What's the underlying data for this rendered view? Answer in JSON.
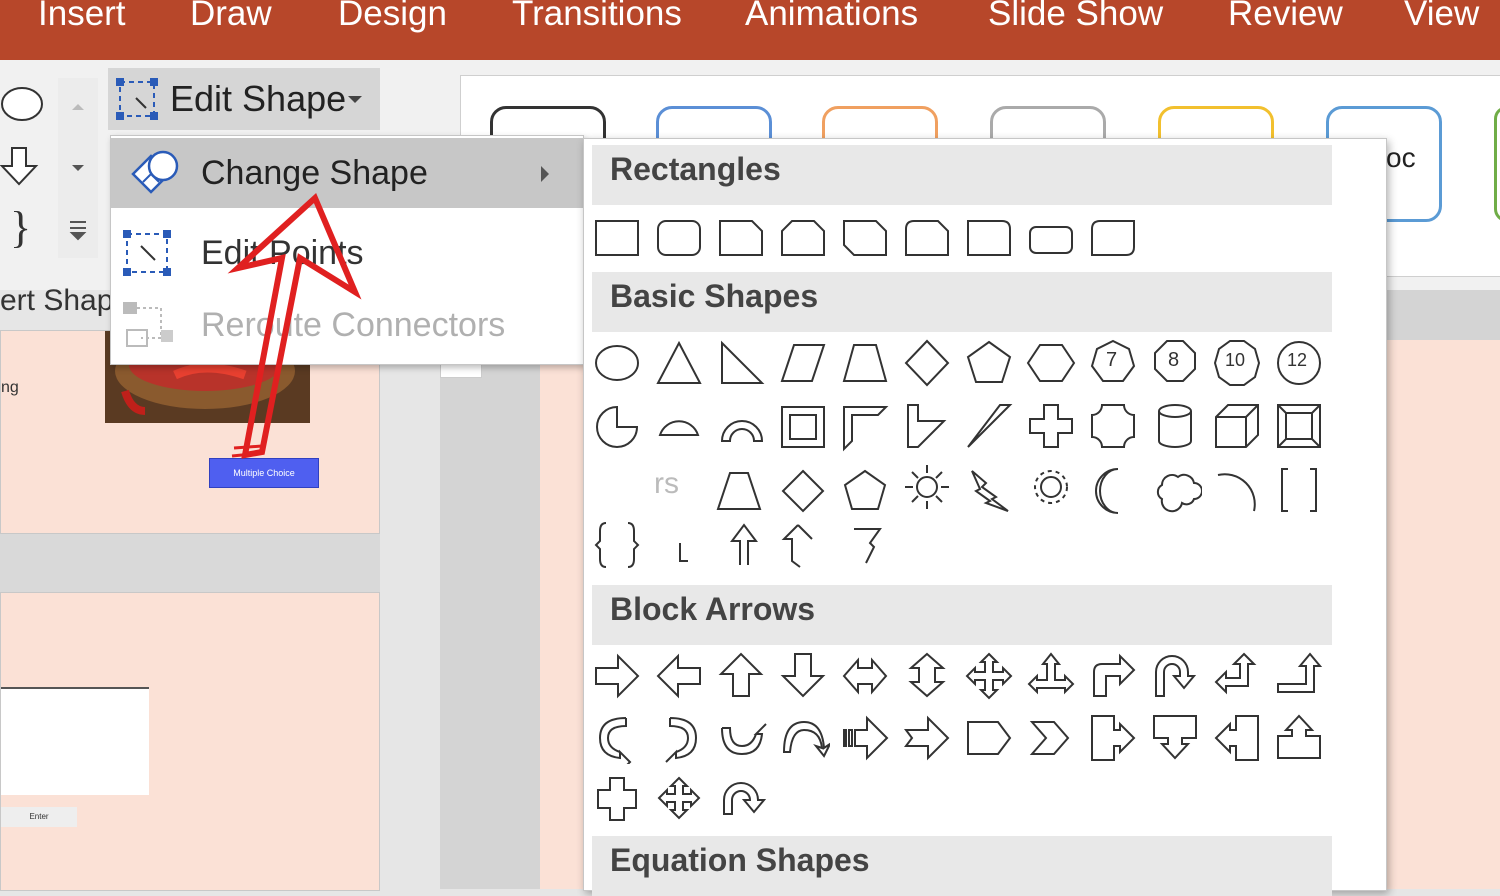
{
  "ribbon_tabs": [
    "Insert",
    "Draw",
    "Design",
    "Transitions",
    "Animations",
    "Slide Show",
    "Review",
    "View"
  ],
  "insert_shapes_label": "ert Shap",
  "edit_shape": {
    "button_label": "Edit Shape",
    "menu": [
      {
        "label": "Change Shape",
        "has_submenu": true,
        "enabled": true
      },
      {
        "label": "Edit Points",
        "enabled": true
      },
      {
        "label": "Reroute Connectors",
        "enabled": false
      }
    ]
  },
  "shapes_gallery": {
    "sections": [
      "Rectangles",
      "Basic Shapes",
      "Block Arrows",
      "Equation Shapes"
    ],
    "basic_number_labels": [
      "7",
      "8",
      "10",
      "12"
    ],
    "partial_text": "rs"
  },
  "style_gallery_partial_text": "oc",
  "slide_thumbnails": {
    "partial_text": "ng",
    "button_label": "Multiple Choice",
    "small_label": "Enter"
  },
  "colors": {
    "ribbon_accent": "#b7472a",
    "slide_background": "#fbe1d6",
    "annotation_arrow": "#e02020",
    "thumbnail_button": "#4f5ff0"
  }
}
